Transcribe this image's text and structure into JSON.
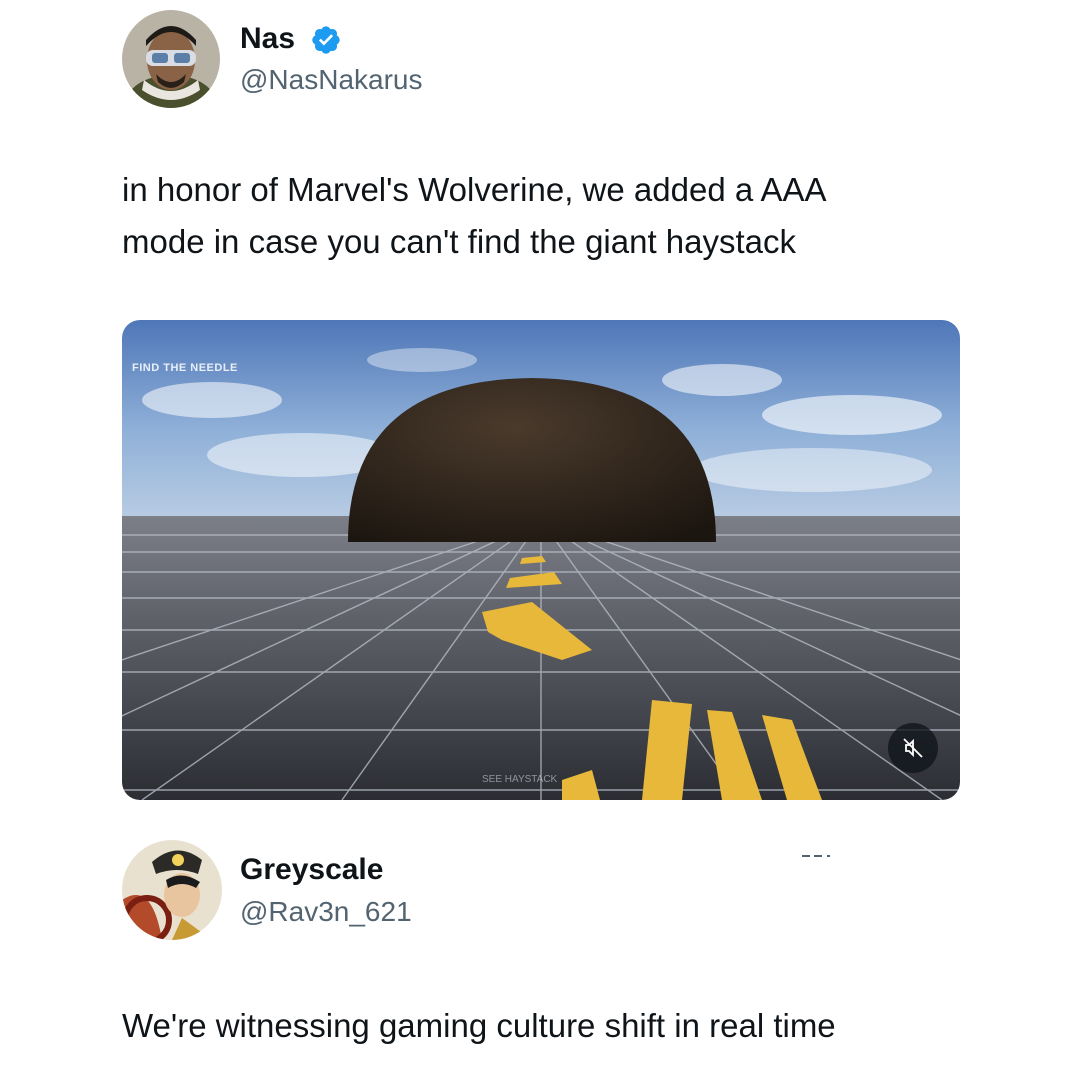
{
  "tweet": {
    "author_name": "Nas",
    "verified": true,
    "author_handle": "@NasNakarus",
    "text_line1": "in honor of Marvel's Wolverine, we added a AAA",
    "text_line2": "mode in case you can't find the giant haystack",
    "media": {
      "hud_label": "FIND THE NEEDLE",
      "icon": "mute-icon"
    }
  },
  "reply": {
    "author_name": "Greyscale",
    "author_handle": "@Rav3n_621",
    "text": "We're witnessing gaming culture shift in real time",
    "menu_icon": "more-icon"
  },
  "colors": {
    "verified_badge": "#1d9bf0",
    "text_primary": "#0f1419",
    "text_secondary": "#536471"
  }
}
